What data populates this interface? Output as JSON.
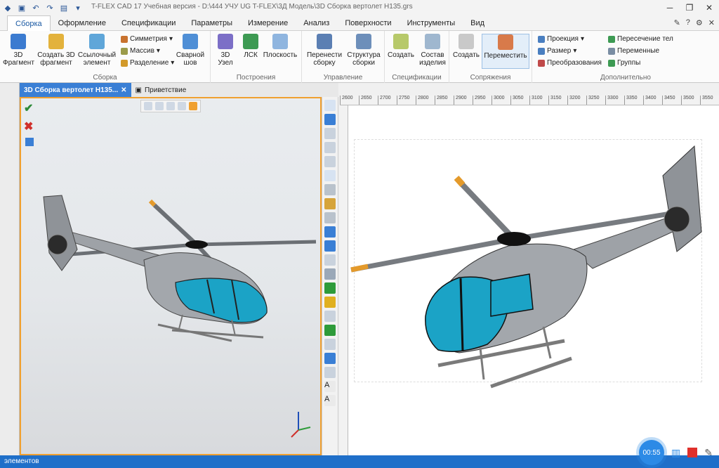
{
  "window": {
    "title": "T-FLEX CAD 17 Учебная версия - D:\\444 УЧУ UG T-FLEX\\3Д Модель\\3D Сборка вертолет H135.grs"
  },
  "ribbon": {
    "tabs": [
      "Сборка",
      "Оформление",
      "Спецификации",
      "Параметры",
      "Измерение",
      "Анализ",
      "Поверхности",
      "Инструменты",
      "Вид"
    ],
    "groups": {
      "assembly": {
        "label": "Сборка",
        "buttons": [
          "3D\nФрагмент",
          "Создать 3D\nфрагмент",
          "Ссылочный\nэлемент"
        ],
        "small": [
          "Симметрия",
          "Массив",
          "Разделение"
        ],
        "weld": "Сварной\nшов"
      },
      "constructions": {
        "label": "Построения",
        "buttons": [
          "3D\nУзел",
          "ЛСК",
          "Плоскость"
        ]
      },
      "management": {
        "label": "Управление",
        "buttons": [
          "Перенести\nсборку",
          "Структура\nсборки"
        ]
      },
      "specifications": {
        "label": "Спецификации",
        "buttons": [
          "Создать",
          "Состав\nизделия"
        ]
      },
      "mates": {
        "label": "Сопряжения",
        "buttons": [
          "Создать",
          "Переместить"
        ]
      },
      "additional": {
        "label": "Дополнительно",
        "small_col1": [
          "Проекция",
          "Размер",
          "Преобразования"
        ],
        "small_col2": [
          "Пересечение тел",
          "Переменные",
          "Группы"
        ]
      }
    }
  },
  "documents": {
    "tabs": [
      "3D Сборка вертолет H135...",
      "Приветствие"
    ]
  },
  "drawing": {
    "ruler_ticks": [
      "2600",
      "2650",
      "2700",
      "2750",
      "2800",
      "2850",
      "2900",
      "2950",
      "3000",
      "3050",
      "3100",
      "3150",
      "3200",
      "3250",
      "3300",
      "3350",
      "3400",
      "3450",
      "3500",
      "3550"
    ]
  },
  "status": {
    "text": "элементов",
    "timer": "00:55"
  },
  "colors": {
    "accent": "#1f6fc9",
    "canopy": "#1ba3c6",
    "body": "#9ea2a7",
    "rotor_tip": "#e49a2b"
  }
}
